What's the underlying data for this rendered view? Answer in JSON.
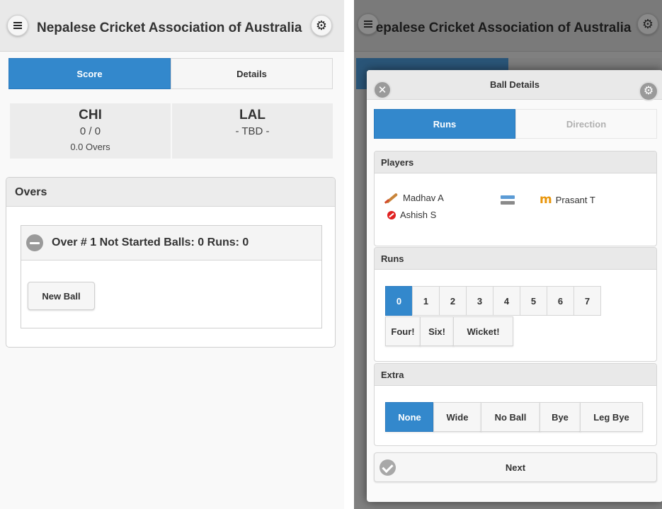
{
  "left": {
    "header": {
      "title": "Nepalese Cricket Association of Australia",
      "menu_icon": "hamburger-icon",
      "settings_icon": "gear-icon"
    },
    "tabs": [
      {
        "label": "Score",
        "active": true
      },
      {
        "label": "Details",
        "active": false
      }
    ],
    "teams": [
      {
        "name": "CHI",
        "score": "0 / 0",
        "overs": "0.0 Overs"
      },
      {
        "name": "LAL",
        "score": "- TBD -"
      }
    ],
    "overs_panel": {
      "title": "Overs",
      "over": {
        "title": "Over # 1 Not Started Balls: 0 Runs: 0",
        "new_ball_label": "New Ball"
      }
    }
  },
  "right": {
    "header": {
      "title": "Nepalese Cricket Association of Australia",
      "menu_icon": "hamburger-icon",
      "settings_icon": "gear-icon"
    },
    "dialog": {
      "title": "Ball Details",
      "tabs": [
        {
          "label": "Runs",
          "active": true
        },
        {
          "label": "Direction",
          "active": false
        }
      ],
      "players": {
        "title": "Players",
        "batsman_striker": "Madhav A",
        "bowler": "Ashish S",
        "batsman_non_striker": "Prasant T"
      },
      "runs": {
        "title": "Runs",
        "numbers": [
          "0",
          "1",
          "2",
          "3",
          "4",
          "5",
          "6",
          "7"
        ],
        "selected": "0",
        "special": [
          "Four!",
          "Six!",
          "Wicket!"
        ]
      },
      "extra": {
        "title": "Extra",
        "options": [
          "None",
          "Wide",
          "No Ball",
          "Bye",
          "Leg Bye"
        ],
        "selected": "None"
      },
      "next_label": "Next"
    }
  },
  "colors": {
    "accent": "#3388cc",
    "overlay": "#808080",
    "header": "#e9e9e9"
  }
}
